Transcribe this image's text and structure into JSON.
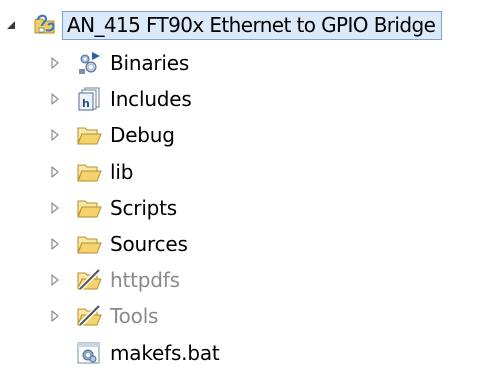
{
  "project": {
    "label": "AN_415 FT90x Ethernet to GPIO Bridge",
    "icon": "project-folder-icon",
    "expanded": true
  },
  "items": [
    {
      "label": "Binaries",
      "icon": "binaries-icon",
      "expandable": true,
      "dim": false
    },
    {
      "label": "Includes",
      "icon": "includes-icon",
      "expandable": true,
      "dim": false
    },
    {
      "label": "Debug",
      "icon": "folder-icon",
      "expandable": true,
      "dim": false
    },
    {
      "label": "lib",
      "icon": "folder-icon",
      "expandable": true,
      "dim": false
    },
    {
      "label": "Scripts",
      "icon": "folder-icon",
      "expandable": true,
      "dim": false
    },
    {
      "label": "Sources",
      "icon": "folder-icon",
      "expandable": true,
      "dim": false
    },
    {
      "label": "httpdfs",
      "icon": "excluded-folder-icon",
      "expandable": true,
      "dim": true
    },
    {
      "label": "Tools",
      "icon": "excluded-folder-icon",
      "expandable": true,
      "dim": true
    },
    {
      "label": "makefs.bat",
      "icon": "batch-file-icon",
      "expandable": false,
      "dim": false
    }
  ],
  "colors": {
    "selection_bg": "#dce9f9",
    "selection_border": "#7da2ce",
    "folder_fill": "#f6d77c",
    "folder_stroke": "#b88f28",
    "dim_text": "#8a8a8a"
  }
}
